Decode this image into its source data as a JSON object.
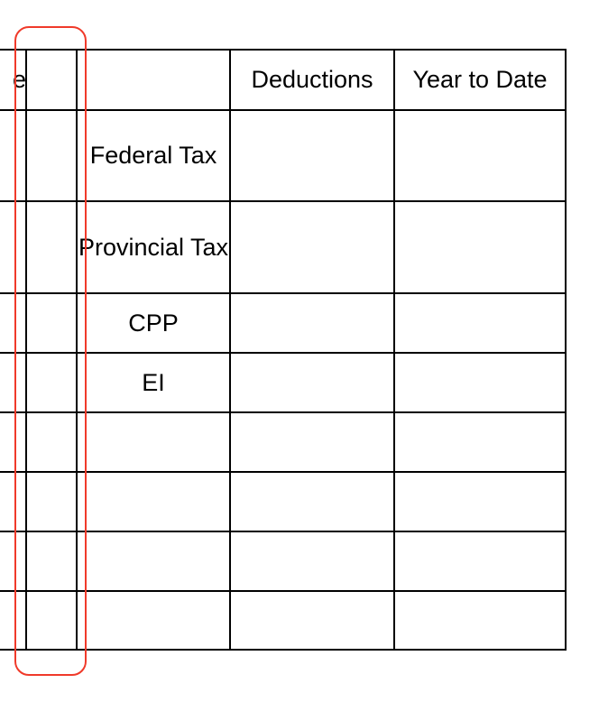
{
  "table": {
    "headers": [
      "e",
      "",
      "",
      "Deductions",
      "Year to Date"
    ],
    "deduction_rows": [
      "Federal Tax",
      "Provincial Tax",
      "CPP",
      "EI",
      "",
      "",
      "",
      ""
    ]
  },
  "highlight": {
    "color": "#f03a2a",
    "target": "column 2"
  }
}
